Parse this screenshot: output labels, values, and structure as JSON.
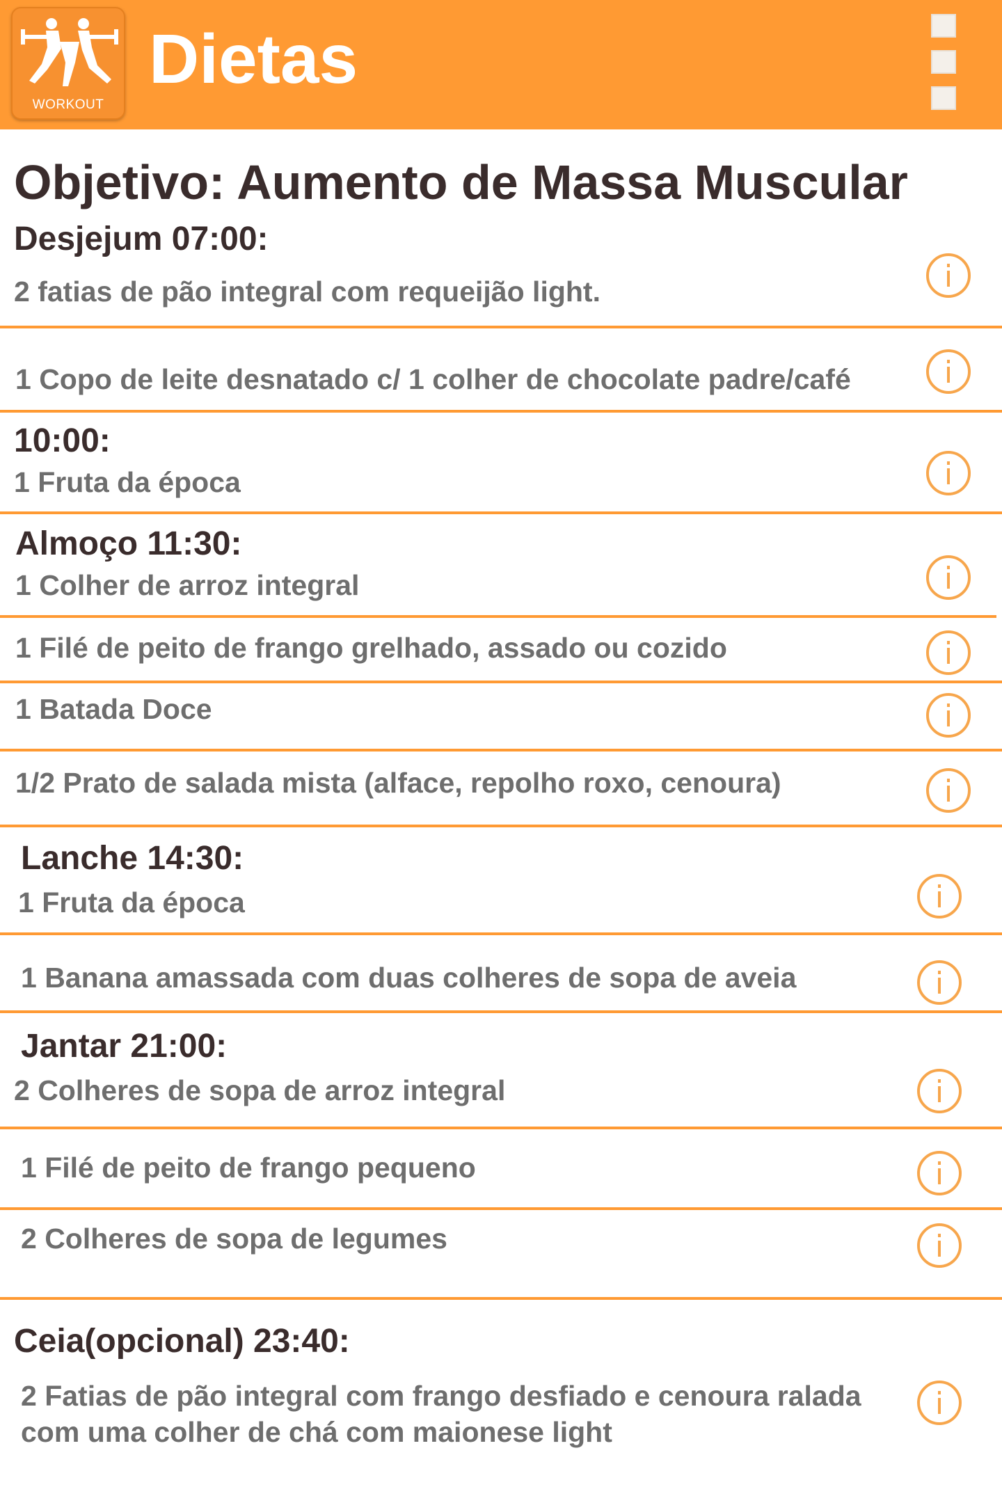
{
  "header": {
    "title": "Dietas",
    "logo_text": "WORKOUT"
  },
  "objective": "Objetivo: Aumento de Massa Muscular",
  "meals": [
    {
      "title": "Desjejum 07:00:",
      "items": [
        "2 fatias de pão integral com requeijão light.",
        "1 Copo de leite desnatado c/ 1 colher de chocolate padre/café"
      ]
    },
    {
      "title": "10:00:",
      "items": [
        "1 Fruta da época"
      ]
    },
    {
      "title": "Almoço 11:30:",
      "items": [
        "1 Colher de arroz integral",
        "1 Filé de peito de frango grelhado, assado ou cozido",
        "1 Batada Doce",
        "1/2 Prato de salada mista (alface, repolho roxo, cenoura)"
      ]
    },
    {
      "title": "Lanche 14:30:",
      "items": [
        "1 Fruta da época",
        "1 Banana amassada com duas colheres de sopa de aveia"
      ]
    },
    {
      "title": "Jantar 21:00:",
      "items": [
        "2 Colheres de sopa de arroz integral",
        "1 Filé de peito de frango pequeno",
        "2 Colheres de sopa de legumes"
      ]
    },
    {
      "title": "Ceia(opcional) 23:40:",
      "items": [
        "2 Fatias de pão integral com frango desfiado e cenoura ralada com uma colher de chá com maionese light"
      ]
    }
  ],
  "icons": {
    "info": "info-circle-icon",
    "menu": "overflow-menu-icon",
    "logo": "workout-logo-icon"
  },
  "colors": {
    "accent": "#ff9a33",
    "title_text": "#3a2c2c",
    "item_text": "#6e6e6e"
  }
}
